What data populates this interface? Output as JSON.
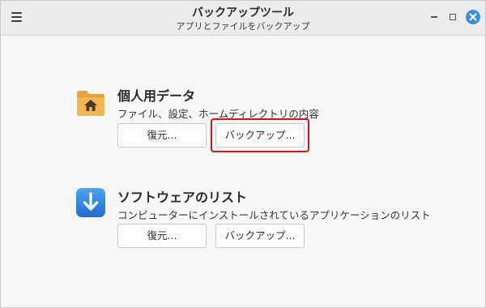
{
  "window": {
    "title": "バックアップツール",
    "subtitle": "アプリとファイルをバックアップ"
  },
  "sections": [
    {
      "title": "個人用データ",
      "description": "ファイル、設定、ホームディレクトリの内容",
      "icon": "home-folder-icon",
      "restore_label": "復元...",
      "backup_label": "バックアップ..."
    },
    {
      "title": "ソフトウェアのリスト",
      "description": "コンピューターにインストールされているアプリケーションのリスト",
      "icon": "download-arrow-icon",
      "restore_label": "復元...",
      "backup_label": "バックアップ..."
    }
  ],
  "colors": {
    "highlight": "#d8141b",
    "close_button": "#3a8fd9",
    "folder": "#f0b04a",
    "software_icon": "#2f86de"
  }
}
